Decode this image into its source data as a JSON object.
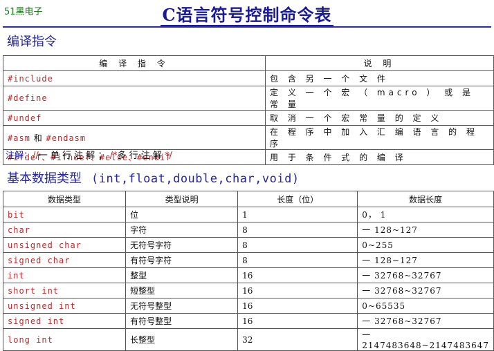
{
  "brand": "51黑电子",
  "title": "C语言符号控制命令表",
  "section1": {
    "heading": "编译指令",
    "columns": [
      "编 译 指 令",
      "说 明"
    ],
    "rows": [
      {
        "dir": "#include",
        "desc": "包 含 另 一 个 文 件"
      },
      {
        "dir": "#define",
        "desc": "定 义 一 个 宏 （ macro ） 或 是 常 量"
      },
      {
        "dir": "#undef",
        "desc": "取 消 一 个 宏 常 量 的 定 义"
      },
      {
        "dir_a": "#asm",
        "dir_join": " 和 ",
        "dir_b": "#endasm",
        "desc": "在 程 序 中 加 入 汇 编 语 言 的 程 序"
      },
      {
        "dir": "#ifdef、#ifndef、#else、#endif",
        "desc": "用 于 条 件 式 的 编 译"
      }
    ]
  },
  "note": {
    "label": "注解：",
    "single_mark": "//",
    "single_text": "一 单 行 注 解 ；",
    "multi_open": "/*",
    "multi_text": "多 行 注 解 ",
    "multi_close": "*/"
  },
  "section2": {
    "heading": "基本数据类型",
    "types_label": "(int,float,double,char,void)",
    "columns": [
      "数据类型",
      "类型说明",
      "长度（位）",
      "数据长度"
    ],
    "rows": [
      {
        "type": "bit",
        "desc": "位",
        "bits": "1",
        "range": "0， 1"
      },
      {
        "type": "char",
        "desc": "字符",
        "bits": "8",
        "range": "一 128~127"
      },
      {
        "type": "unsigned char",
        "desc": "无符号字符",
        "bits": "8",
        "range": "0~255"
      },
      {
        "type": "signed char",
        "desc": "有符号字符",
        "bits": "8",
        "range": "一 128~127"
      },
      {
        "type": "int",
        "desc": "整型",
        "bits": "16",
        "range": "一 32768~32767"
      },
      {
        "type": "short int",
        "desc": "短整型",
        "bits": "16",
        "range": "一 32768~32767"
      },
      {
        "type": "unsigned int",
        "desc": "无符号整型",
        "bits": "16",
        "range": "0~65535"
      },
      {
        "type": "signed int",
        "desc": "有符号整型",
        "bits": "16",
        "range": "一 32768~32767"
      },
      {
        "type": "long int",
        "desc": "长整型",
        "bits": "32",
        "range": "一2147483648~2147483647"
      }
    ]
  }
}
